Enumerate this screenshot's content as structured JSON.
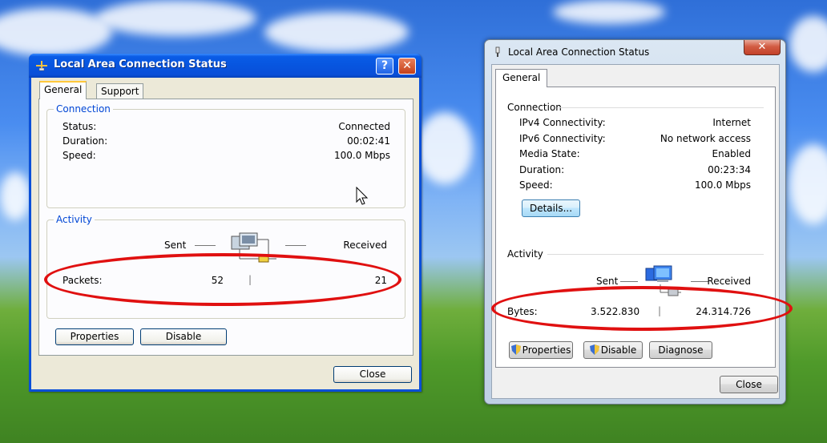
{
  "xp_window": {
    "title": "Local Area Connection Status",
    "help_glyph": "?",
    "close_glyph": "✕",
    "tabs": [
      "General",
      "Support"
    ],
    "connection": {
      "legend": "Connection",
      "rows": [
        {
          "label": "Status:",
          "value": "Connected"
        },
        {
          "label": "Duration:",
          "value": "00:02:41"
        },
        {
          "label": "Speed:",
          "value": "100.0 Mbps"
        }
      ]
    },
    "activity": {
      "legend": "Activity",
      "sent_label": "Sent",
      "received_label": "Received",
      "row_label": "Packets:",
      "sent_value": "52",
      "separator": "|",
      "received_value": "21"
    },
    "buttons": {
      "properties": "Properties",
      "disable": "Disable",
      "close": "Close"
    }
  },
  "w7_window": {
    "title": "Local Area Connection Status",
    "close_glyph": "✕",
    "tab": "General",
    "connection": {
      "heading": "Connection",
      "rows": [
        {
          "label": "IPv4 Connectivity:",
          "value": "Internet"
        },
        {
          "label": "IPv6 Connectivity:",
          "value": "No network access"
        },
        {
          "label": "Media State:",
          "value": "Enabled"
        },
        {
          "label": "Duration:",
          "value": "00:23:34"
        },
        {
          "label": "Speed:",
          "value": "100.0 Mbps"
        }
      ],
      "details_button": "Details..."
    },
    "activity": {
      "heading": "Activity",
      "sent_label": "Sent",
      "received_label": "Received",
      "row_label": "Bytes:",
      "sent_value": "3.522.830",
      "separator": "|",
      "received_value": "24.314.726"
    },
    "buttons": {
      "properties": "Properties",
      "disable": "Disable",
      "diagnose": "Diagnose",
      "close": "Close"
    }
  },
  "colors": {
    "highlight_ellipse": "#e01010",
    "xp_title_blue": "#0a4fd8",
    "xp_legend_blue": "#0046d5"
  }
}
